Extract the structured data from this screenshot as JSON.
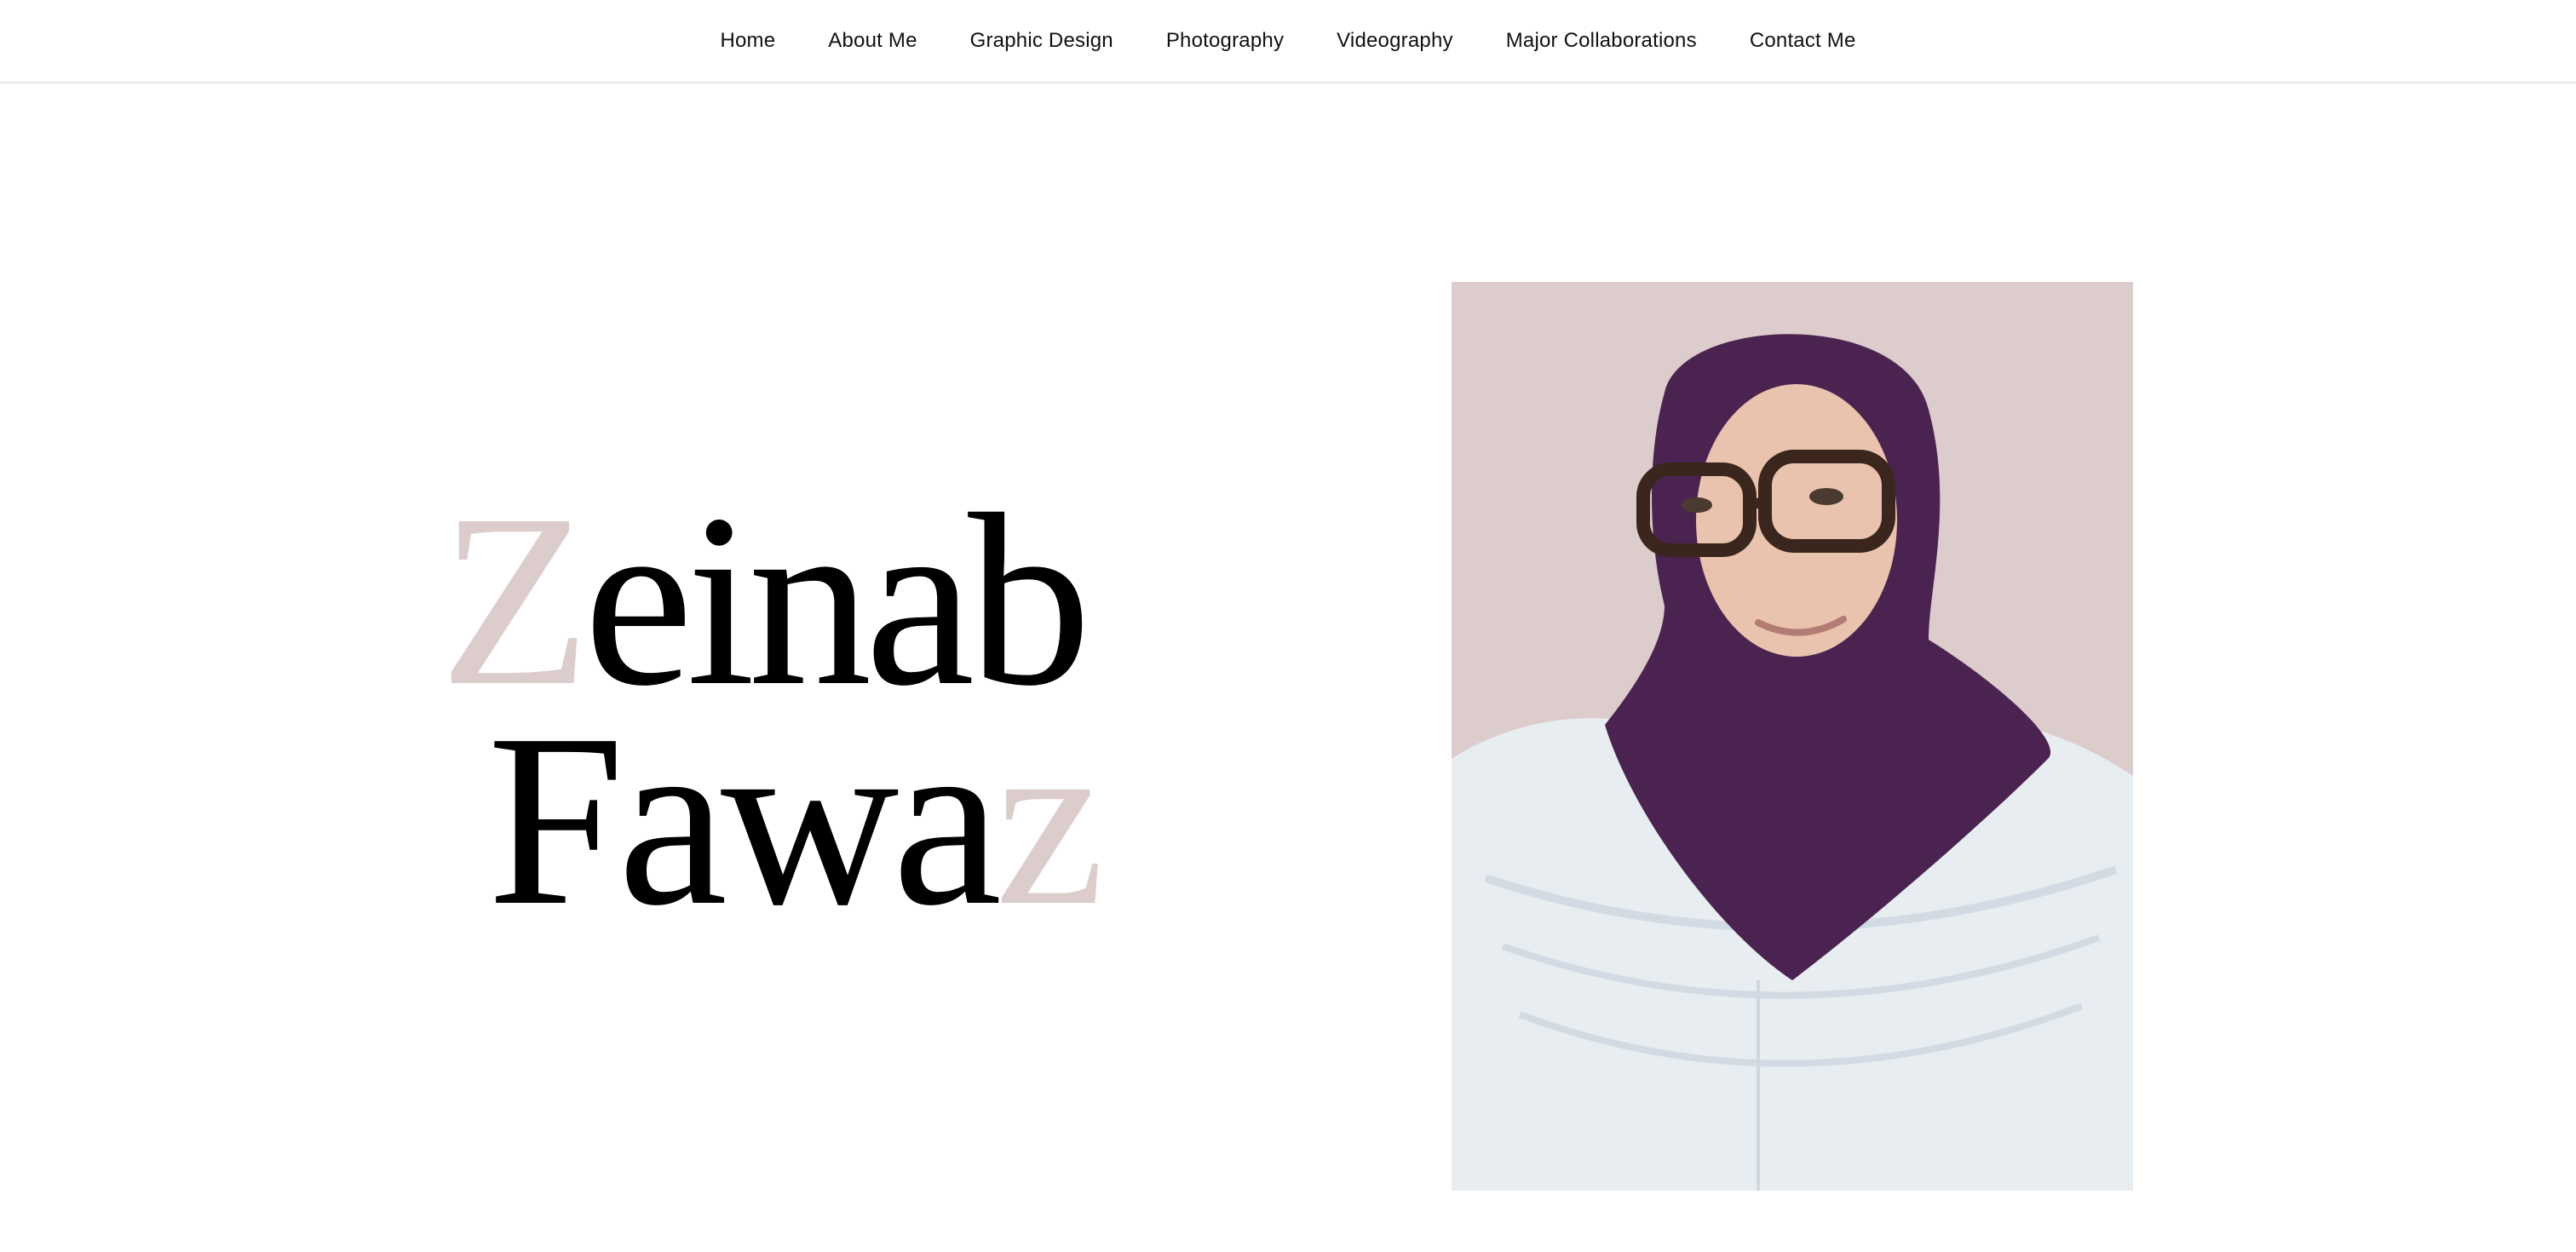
{
  "nav": {
    "items": [
      {
        "label": "Home"
      },
      {
        "label": "About Me"
      },
      {
        "label": "Graphic Design"
      },
      {
        "label": "Photography"
      },
      {
        "label": "Videography"
      },
      {
        "label": "Major Collaborations"
      },
      {
        "label": "Contact Me"
      }
    ]
  },
  "hero": {
    "first_name_initial": "Z",
    "first_name_rest": "einab",
    "last_name_main": "Fawa",
    "last_name_final": "z"
  },
  "colors": {
    "accent": "#dccccc",
    "text": "#000000",
    "background": "#ffffff",
    "portrait_backdrop": "#dccccc",
    "hijab": "#4b2350",
    "shirt": "#e8edf1"
  },
  "portrait": {
    "icon": "portrait-photo-icon"
  }
}
